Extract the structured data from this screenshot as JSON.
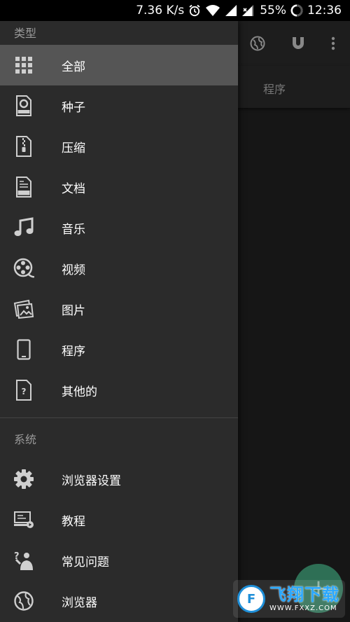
{
  "status_bar": {
    "speed": "7.36 K/s",
    "battery": "55%",
    "time": "12:36"
  },
  "background": {
    "tab_label": "程序",
    "fab_label": "+"
  },
  "drawer": {
    "types_header": "类型",
    "types": [
      {
        "label": "全部",
        "icon": "grid-icon",
        "active": true
      },
      {
        "label": "种子",
        "icon": "torrent-file-icon"
      },
      {
        "label": "压缩",
        "icon": "zip-file-icon"
      },
      {
        "label": "文档",
        "icon": "doc-file-icon"
      },
      {
        "label": "音乐",
        "icon": "music-note-icon"
      },
      {
        "label": "视频",
        "icon": "film-reel-icon"
      },
      {
        "label": "图片",
        "icon": "pictures-icon"
      },
      {
        "label": "程序",
        "icon": "phone-app-icon"
      },
      {
        "label": "其他的",
        "icon": "unknown-file-icon"
      }
    ],
    "system_header": "系统",
    "system": [
      {
        "label": "浏览器设置",
        "icon": "gear-icon"
      },
      {
        "label": "教程",
        "icon": "tutorial-icon"
      },
      {
        "label": "常见问题",
        "icon": "faq-icon"
      },
      {
        "label": "浏览器",
        "icon": "globe-icon"
      }
    ]
  },
  "watermark": {
    "title": "飞翔下载",
    "subtitle": "WWW.FXXZ.COM",
    "logo_glyph": "F"
  },
  "colors": {
    "drawer_bg": "#2b2b2b",
    "active_item_bg": "#555555",
    "fab": "#2e6f55"
  }
}
